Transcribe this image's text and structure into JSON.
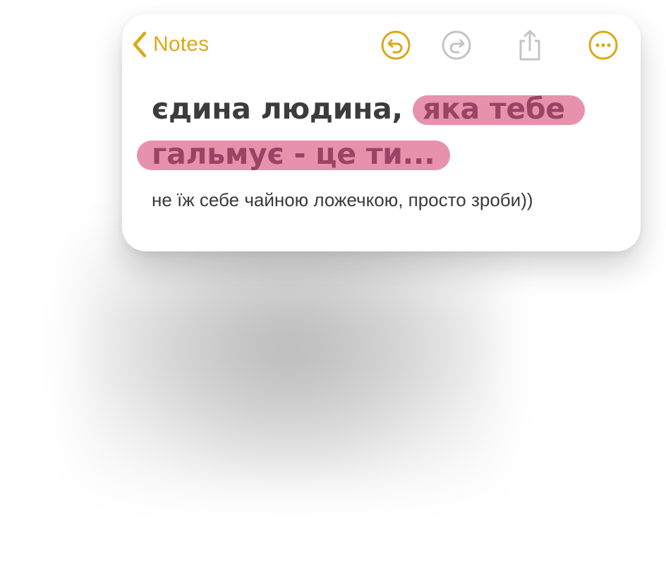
{
  "nav": {
    "back_label": "Notes",
    "accent_color": "#d9a91a"
  },
  "toolbar": {
    "icons": [
      "undo-icon",
      "redo-icon",
      "share-icon",
      "more-icon"
    ]
  },
  "note": {
    "title_plain": "єдина людина,",
    "title_highlight_1": "яка тебе",
    "title_highlight_2": "гальмує - це ти...",
    "body": "не їж себе чайною ложечкою, просто зроби))",
    "highlight_color": "#e891ad"
  }
}
